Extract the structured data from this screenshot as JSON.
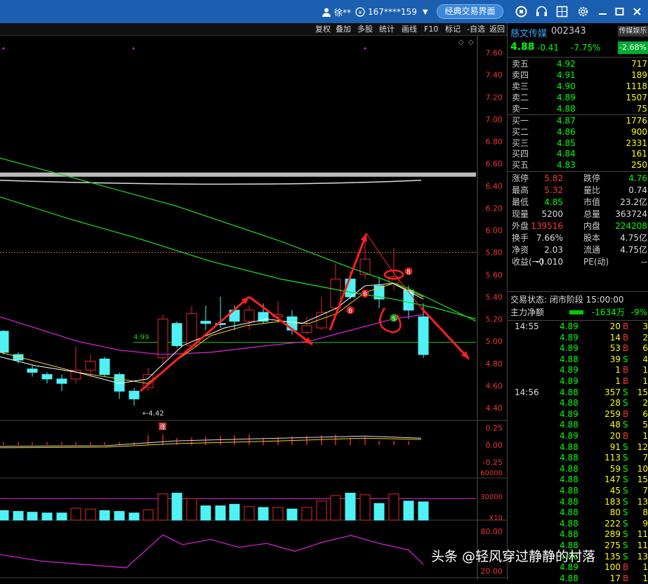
{
  "titlebar": {
    "user": "徐**",
    "account": "167****159",
    "classic_btn": "经典交易界面"
  },
  "toolbar": [
    "复权",
    "叠加",
    "多股",
    "统计",
    "画线",
    "F10",
    "标记",
    "-自选",
    "返回"
  ],
  "chart": {
    "price_axis": [
      "7.60",
      "7.40",
      "7.20",
      "7.00",
      "6.80",
      "6.60",
      "6.40",
      "6.20",
      "6.00",
      "5.80",
      "5.60",
      "5.40",
      "5.20",
      "5.00",
      "4.80",
      "4.60",
      "4.40"
    ],
    "macd_axis": [
      "0.25",
      "0.00",
      "-0.25"
    ],
    "vol_axis": [
      "60000",
      "30000",
      "X10"
    ],
    "rsi_axis": [
      "80.00",
      "20.00"
    ],
    "annotations": {
      "level": "4.99",
      "low": "4.42",
      "zhang": "涨",
      "b": "B",
      "s": "S"
    },
    "colors": {
      "up": "#e8242a",
      "down": "#4ef2f5",
      "ma5": "#ffffff",
      "ma10": "#f0d020",
      "ma20": "#d020d0",
      "ma60": "#20d020",
      "arrow": "#ff2020"
    }
  },
  "stock": {
    "name": "慈文传媒",
    "code": "002343",
    "sector": "传媒娱乐",
    "price": "4.88",
    "change": "-0.41",
    "pct": "-7.75%",
    "sector_pct": "-2.68%"
  },
  "asks": [
    {
      "l": "卖五",
      "p": "4.92",
      "v": "717"
    },
    {
      "l": "卖四",
      "p": "4.91",
      "v": "189"
    },
    {
      "l": "卖三",
      "p": "4.90",
      "v": "1118"
    },
    {
      "l": "卖二",
      "p": "4.89",
      "v": "1507"
    },
    {
      "l": "卖一",
      "p": "4.88",
      "v": "75"
    }
  ],
  "bids": [
    {
      "l": "买一",
      "p": "4.87",
      "v": "1776"
    },
    {
      "l": "买二",
      "p": "4.86",
      "v": "900"
    },
    {
      "l": "买三",
      "p": "4.85",
      "v": "2331"
    },
    {
      "l": "买四",
      "p": "4.84",
      "v": "161"
    },
    {
      "l": "买五",
      "p": "4.83",
      "v": "250"
    }
  ],
  "stats": [
    [
      "涨停",
      "5.82",
      "跌停",
      "4.76"
    ],
    [
      "最高",
      "5.32",
      "量比",
      "0.74"
    ],
    [
      "最低",
      "4.85",
      "市值",
      "23.2亿"
    ],
    [
      "现量",
      "5200",
      "总量",
      "363724"
    ],
    [
      "外盘",
      "139516",
      "内盘",
      "224208"
    ],
    [
      "换手",
      "7.66%",
      "股本",
      "4.75亿"
    ],
    [
      "净资",
      "2.03",
      "流通",
      "4.75亿"
    ],
    [
      "收益(一)",
      "-0.010",
      "PE(动)",
      "--"
    ]
  ],
  "trade_status": "交易状态: 闭市阶段 15:00:00",
  "main_force": {
    "label": "主力净额",
    "value": "-1634万",
    "pct": "-9%"
  },
  "ticks": [
    {
      "t": "14:55",
      "p": "4.89",
      "v": "20",
      "s": "B",
      "n": "3"
    },
    {
      "t": "",
      "p": "4.89",
      "v": "14",
      "s": "B",
      "n": "2"
    },
    {
      "t": "",
      "p": "4.89",
      "v": "53",
      "s": "B",
      "n": "6"
    },
    {
      "t": "",
      "p": "4.88",
      "v": "39",
      "s": "S",
      "n": "4"
    },
    {
      "t": "",
      "p": "4.89",
      "v": "1",
      "s": "B",
      "n": "1"
    },
    {
      "t": "",
      "p": "4.89",
      "v": "1",
      "s": "B",
      "n": "1"
    },
    {
      "t": "14:56",
      "p": "4.88",
      "v": "357",
      "s": "S",
      "n": "15"
    },
    {
      "t": "",
      "p": "4.88",
      "v": "28",
      "s": "S",
      "n": "2"
    },
    {
      "t": "",
      "p": "4.89",
      "v": "259",
      "s": "B",
      "n": "6"
    },
    {
      "t": "",
      "p": "4.88",
      "v": "48",
      "s": "S",
      "n": "5"
    },
    {
      "t": "",
      "p": "4.89",
      "v": "20",
      "s": "B",
      "n": "1"
    },
    {
      "t": "",
      "p": "4.88",
      "v": "91",
      "s": "S",
      "n": "12"
    },
    {
      "t": "",
      "p": "4.88",
      "v": "113",
      "s": "S",
      "n": "7"
    },
    {
      "t": "",
      "p": "4.88",
      "v": "59",
      "s": "S",
      "n": "10"
    },
    {
      "t": "",
      "p": "4.88",
      "v": "147",
      "s": "S",
      "n": "15"
    },
    {
      "t": "",
      "p": "4.88",
      "v": "45",
      "s": "S",
      "n": "7"
    },
    {
      "t": "",
      "p": "4.88",
      "v": "183",
      "s": "S",
      "n": "13"
    },
    {
      "t": "",
      "p": "4.88",
      "v": "80",
      "s": "S",
      "n": "8"
    },
    {
      "t": "",
      "p": "4.88",
      "v": "222",
      "s": "S",
      "n": "9"
    },
    {
      "t": "",
      "p": "4.88",
      "v": "289",
      "s": "S",
      "n": "11"
    },
    {
      "t": "",
      "p": "4.88",
      "v": "275",
      "s": "S",
      "n": "11"
    },
    {
      "t": "",
      "p": "4.88",
      "v": "135",
      "s": "S",
      "n": "13"
    },
    {
      "t": "",
      "p": "4.89",
      "v": "100",
      "s": "B",
      "n": "1"
    },
    {
      "t": "",
      "p": "4.88",
      "v": "17",
      "s": "B",
      "n": "1"
    }
  ],
  "watermark": "头条 @轻风穿过静静的村落"
}
